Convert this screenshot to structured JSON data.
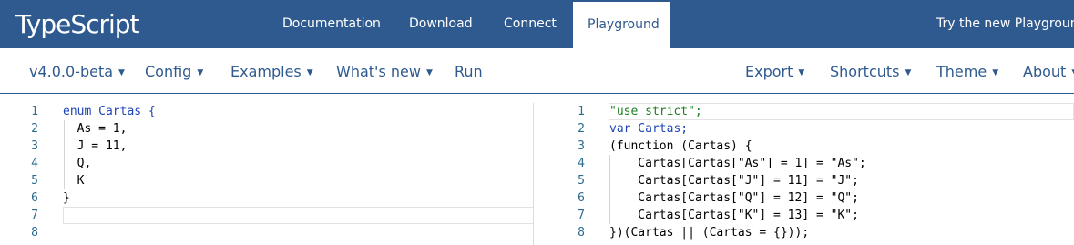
{
  "header": {
    "brand": "TypeScript",
    "links": [
      "Documentation",
      "Download",
      "Connect",
      "Playground"
    ],
    "try_new": "Try the new Playground"
  },
  "toolbar": {
    "version": "v4.0.0-beta",
    "config": "Config",
    "examples": "Examples",
    "whats_new": "What's new",
    "run": "Run",
    "export": "Export",
    "shortcuts": "Shortcuts",
    "theme": "Theme",
    "about": "About"
  },
  "left_editor": {
    "line_numbers": [
      "1",
      "2",
      "3",
      "4",
      "5",
      "6",
      "7",
      "8"
    ],
    "lines": [
      "enum Cartas {",
      "  As = 1,",
      "  J = 11,",
      "  Q,",
      "  K",
      "}",
      "",
      ""
    ]
  },
  "right_editor": {
    "line_numbers": [
      "1",
      "2",
      "3",
      "4",
      "5",
      "6",
      "7",
      "8"
    ],
    "lines": [
      "\"use strict\";",
      "var Cartas;",
      "(function (Cartas) {",
      "    Cartas[Cartas[\"As\"] = 1] = \"As\";",
      "    Cartas[Cartas[\"J\"] = 11] = \"J\";",
      "    Cartas[Cartas[\"Q\"] = 12] = \"Q\";",
      "    Cartas[Cartas[\"K\"] = 13] = \"K\";",
      "})(Cartas || (Cartas = {}));"
    ]
  },
  "colors": {
    "brand": "#2f5a8f",
    "keyword": "#1f44b8",
    "number": "#0a7a3a",
    "string": "#1c7f21"
  }
}
